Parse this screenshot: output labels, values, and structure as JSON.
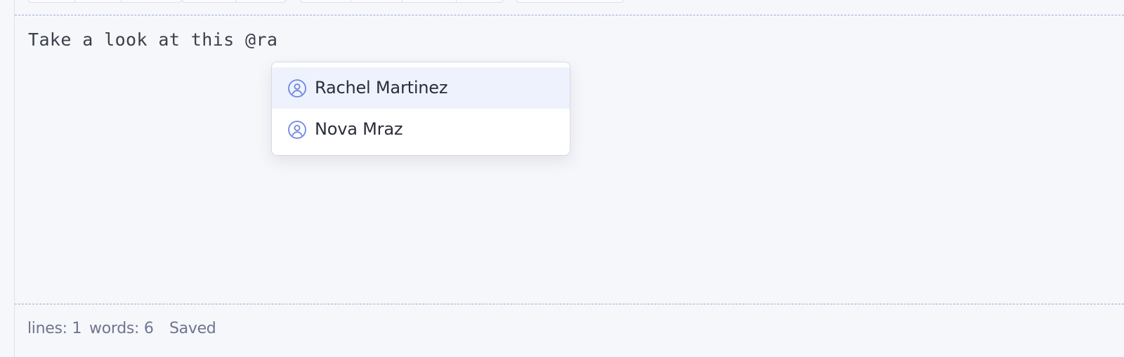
{
  "editor": {
    "text": "Take a look at this @ra"
  },
  "mention_suggestions": [
    {
      "name": "Rachel Martinez",
      "icon": "user-circle-icon",
      "highlighted": true
    },
    {
      "name": "Nova Mraz",
      "icon": "user-circle-icon",
      "highlighted": false
    }
  ],
  "status_bar": {
    "lines": "lines: 1",
    "words": "words: 6",
    "save_state": "Saved"
  },
  "colors": {
    "accent": "#6e86e0",
    "highlight": "#eef2fc",
    "background": "#f6f7fa"
  }
}
